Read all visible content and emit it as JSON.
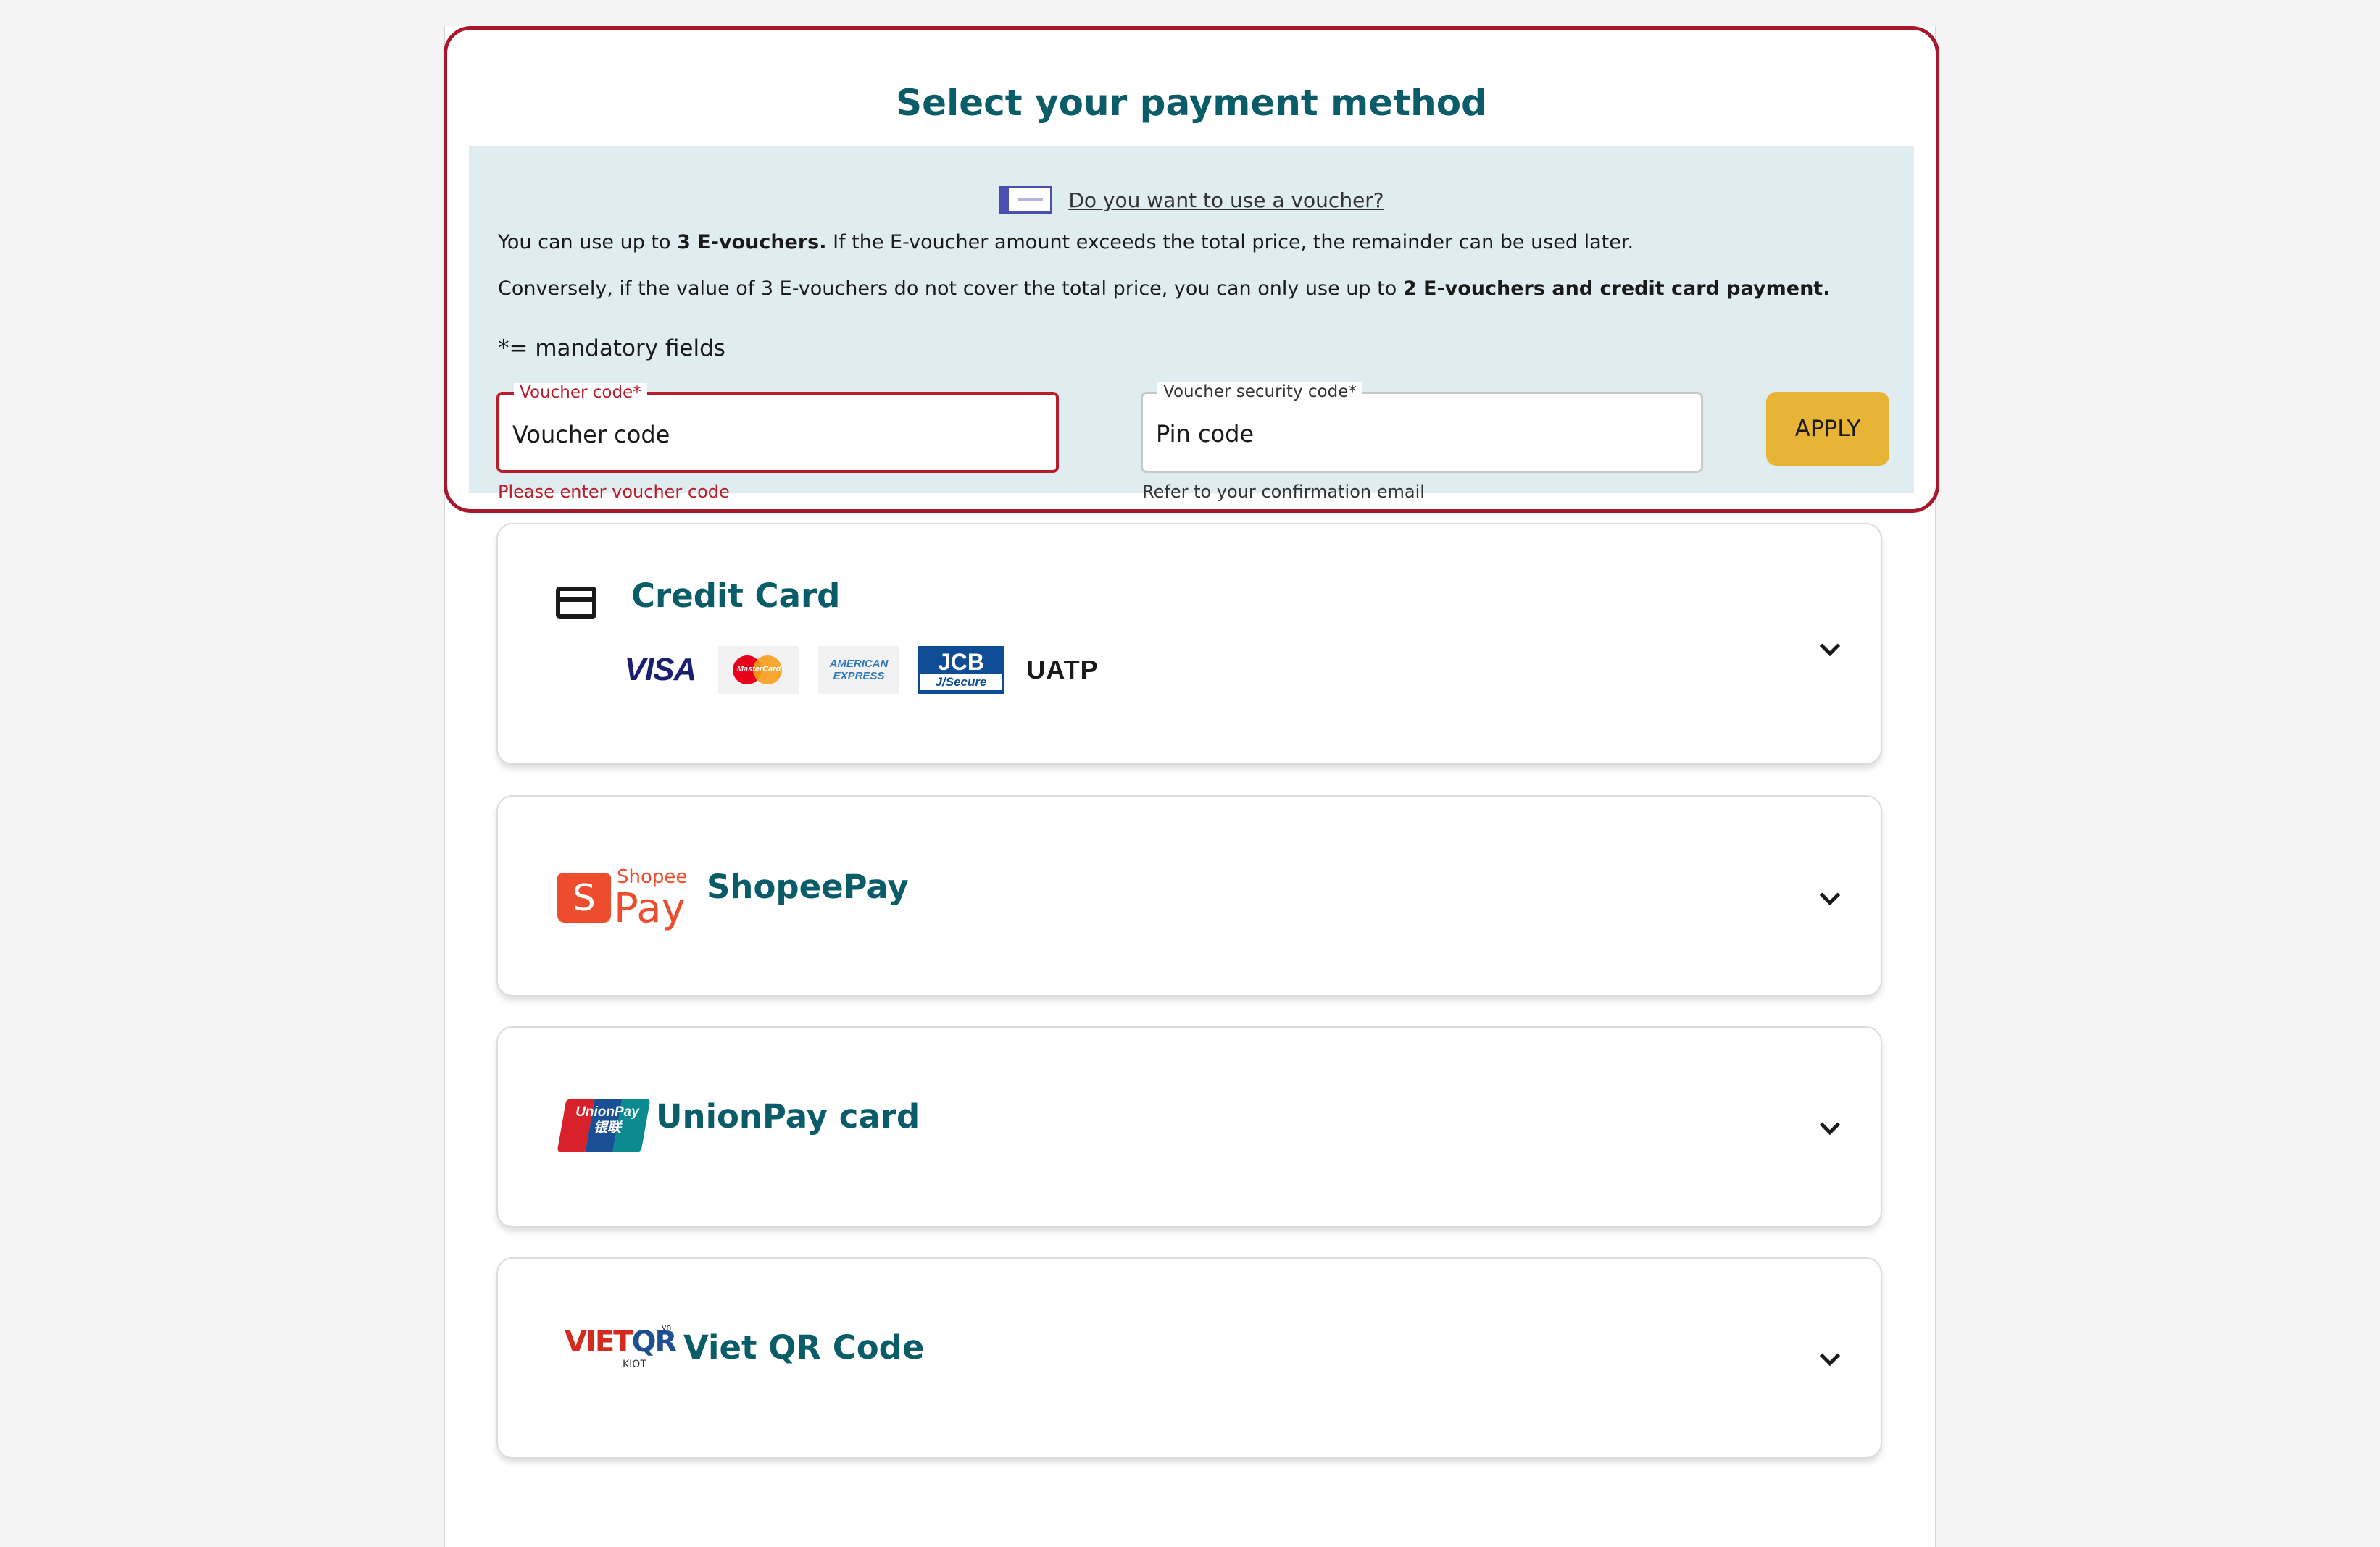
{
  "page": {
    "title": "Select your payment method"
  },
  "voucher": {
    "icon": "voucher-ticket-icon",
    "icon_text": "VOUCHER",
    "link_text": "Do you want to use a voucher?",
    "line1_pre": "You can use up to ",
    "line1_bold": "3 E-vouchers.",
    "line1_post": " If the E-voucher amount exceeds the total price, the remainder can be used later.",
    "line2_pre": "Conversely, if the value of 3 E-vouchers do not cover the total price, you can only use up to ",
    "line2_bold": "2 E-vouchers and credit card payment.",
    "mandatory_note": "*= mandatory fields",
    "code_field": {
      "label": "Voucher code*",
      "placeholder": "Voucher code",
      "value": "",
      "error": "Please enter voucher code"
    },
    "pin_field": {
      "label": "Voucher security code*",
      "placeholder": "Pin code",
      "value": "",
      "helper": "Refer to your confirmation email"
    },
    "apply_label": "APPLY"
  },
  "methods": {
    "credit_card": {
      "name": "Credit Card",
      "icon": "credit-card-icon",
      "brands": {
        "visa": "VISA",
        "mastercard": "MasterCard",
        "amex_line1": "AMERICAN",
        "amex_line2": "EXPRESS",
        "jcb_top": "JCB",
        "jcb_bottom": "J/Secure",
        "uatp": "UATP"
      }
    },
    "shopeepay": {
      "name": "ShopeePay",
      "logo_s": "S",
      "logo_word": "Shopee",
      "logo_pay": "Pay"
    },
    "unionpay": {
      "name": "UnionPay card",
      "logo_line1": "UnionPay",
      "logo_line2": "银联"
    },
    "vietqr": {
      "name": "Viet QR Code",
      "logo_viet": "VIET",
      "logo_qr": "QR",
      "logo_vn": "vn",
      "logo_sub": "KIOT"
    }
  },
  "colors": {
    "accent_teal": "#0a5c68",
    "error_red": "#b81d2a",
    "apply_yellow": "#e8b436",
    "panel_bg": "#e0edf0"
  }
}
